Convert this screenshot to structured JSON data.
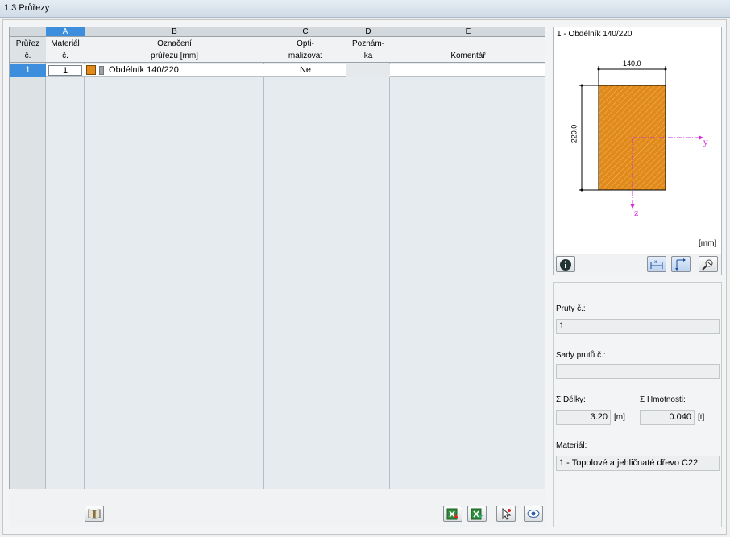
{
  "window": {
    "title": "1.3 Průřezy"
  },
  "table": {
    "col_letters": [
      "A",
      "B",
      "C",
      "D",
      "E"
    ],
    "headers": {
      "rownum": [
        "Průřez",
        "č."
      ],
      "a": [
        "Materiál",
        "č."
      ],
      "b": [
        "Označení",
        "průřezu [mm]"
      ],
      "c": [
        "Opti-",
        "malizovat"
      ],
      "d": [
        "Poznám-",
        "ka"
      ],
      "e": [
        "",
        "Komentář"
      ]
    },
    "rows": [
      {
        "num": "1",
        "material": "1",
        "designation": "Obdélník 140/220",
        "optimize": "Ne",
        "note": "",
        "comment": ""
      }
    ]
  },
  "preview": {
    "title": "1 - Obdélník 140/220",
    "width_label": "140.0",
    "height_label": "220.0",
    "axis_y": "y",
    "axis_z": "z",
    "unit": "[mm]"
  },
  "info": {
    "members_label": "Pruty č.:",
    "members_value": "1",
    "sets_label": "Sady prutů č.:",
    "sets_value": "",
    "length_label": "Σ Délky:",
    "length_value": "3.20",
    "length_unit": "[m]",
    "mass_label": "Σ Hmotnosti:",
    "mass_value": "0.040",
    "mass_unit": "[t]",
    "material_label": "Materiál:",
    "material_value": "1 - Topolové a jehličnaté dřevo C22"
  },
  "colors": {
    "accent": "#3e8ede",
    "timber": "#e08a1c",
    "axis": "#d42cd4"
  }
}
